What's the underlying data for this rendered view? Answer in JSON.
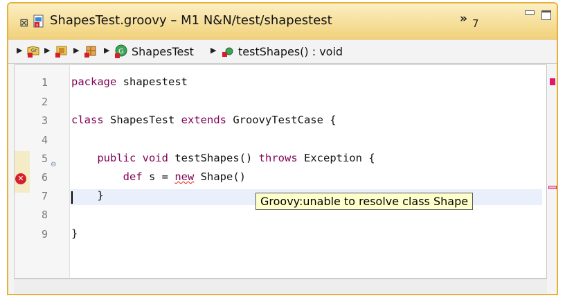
{
  "editor_tab": {
    "close_glyph": "⊠",
    "file_icon": "groovy-test-file-icon",
    "title": "ShapesTest.groovy – M1 N&N/test/shapestest",
    "overflow_chevron": "»",
    "overflow_count": "7"
  },
  "window_controls": {
    "minimize_icon": "minimize-icon",
    "maximize_icon": "maximize-icon"
  },
  "breadcrumb": {
    "items": [
      {
        "icon": "project-icon",
        "label": ""
      },
      {
        "icon": "source-folder-icon",
        "label": ""
      },
      {
        "icon": "package-icon",
        "label": ""
      },
      {
        "icon": "groovy-class-icon",
        "label": "ShapesTest"
      },
      {
        "icon": "method-icon",
        "label": "testShapes() : void"
      }
    ]
  },
  "code": {
    "line_numbers": [
      "1",
      "2",
      "3",
      "4",
      "5",
      "6",
      "7",
      "8",
      "9"
    ],
    "lines": [
      {
        "kw1": "package",
        "rest": " shapestest"
      },
      {
        "text": ""
      },
      {
        "kw1": "class",
        "mid": " ShapesTest ",
        "kw2": "extends",
        "rest": " GroovyTestCase {"
      },
      {
        "text": ""
      },
      {
        "indent": "    ",
        "kw1": "public",
        "mid1": " ",
        "kw2": "void",
        "mid2": " testShapes() ",
        "kw3": "throws",
        "rest": " Exception {"
      },
      {
        "indent": "        ",
        "kw1": "def",
        "mid": " s = ",
        "err": "new",
        "rest": " Shape()"
      },
      {
        "text": "    }"
      },
      {
        "text": ""
      },
      {
        "text": "}"
      }
    ],
    "folding_glyph": "⊖",
    "error_glyph": "✕"
  },
  "tooltip": {
    "text": "Groovy:unable to resolve class Shape"
  },
  "colors": {
    "title_bar_active": "#f1d27a",
    "keyword": "#7f0055",
    "error": "#d3202a",
    "tooltip_bg": "#ffffcc",
    "overview_error": "#e3156d"
  }
}
